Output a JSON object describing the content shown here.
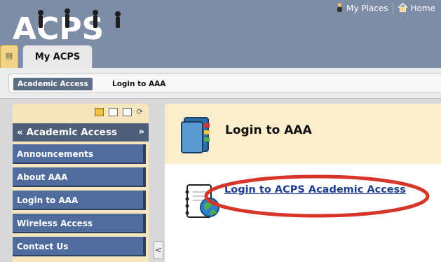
{
  "header": {
    "logo_text": "ACPS",
    "nav": [
      {
        "label": "My Places",
        "icon": "person-icon"
      },
      {
        "label": "Home",
        "icon": "home-icon"
      }
    ],
    "tab_stub_icon": "grid-icon",
    "active_tab": "My ACPS"
  },
  "breadcrumb": {
    "parent": "Academic Access",
    "current": "Login to AAA"
  },
  "sidebar": {
    "title": "Academic Access",
    "collapse_glyph": "«",
    "expand_glyph": "»",
    "items": [
      {
        "label": "Announcements"
      },
      {
        "label": "About AAA"
      },
      {
        "label": "Login to AAA"
      },
      {
        "label": "Wireless Access"
      },
      {
        "label": "Contact Us"
      }
    ],
    "panel_toggle": "<"
  },
  "main": {
    "title": "Login to AAA",
    "link_text": "Login to ACPS Academic Access"
  },
  "colors": {
    "header_bg": "#7d8da6",
    "sidebar_item_bg": "#4f6c9c",
    "main_head_bg": "#fbeecd",
    "link": "#1d3f8e",
    "annotation_oval": "#d8352a"
  }
}
